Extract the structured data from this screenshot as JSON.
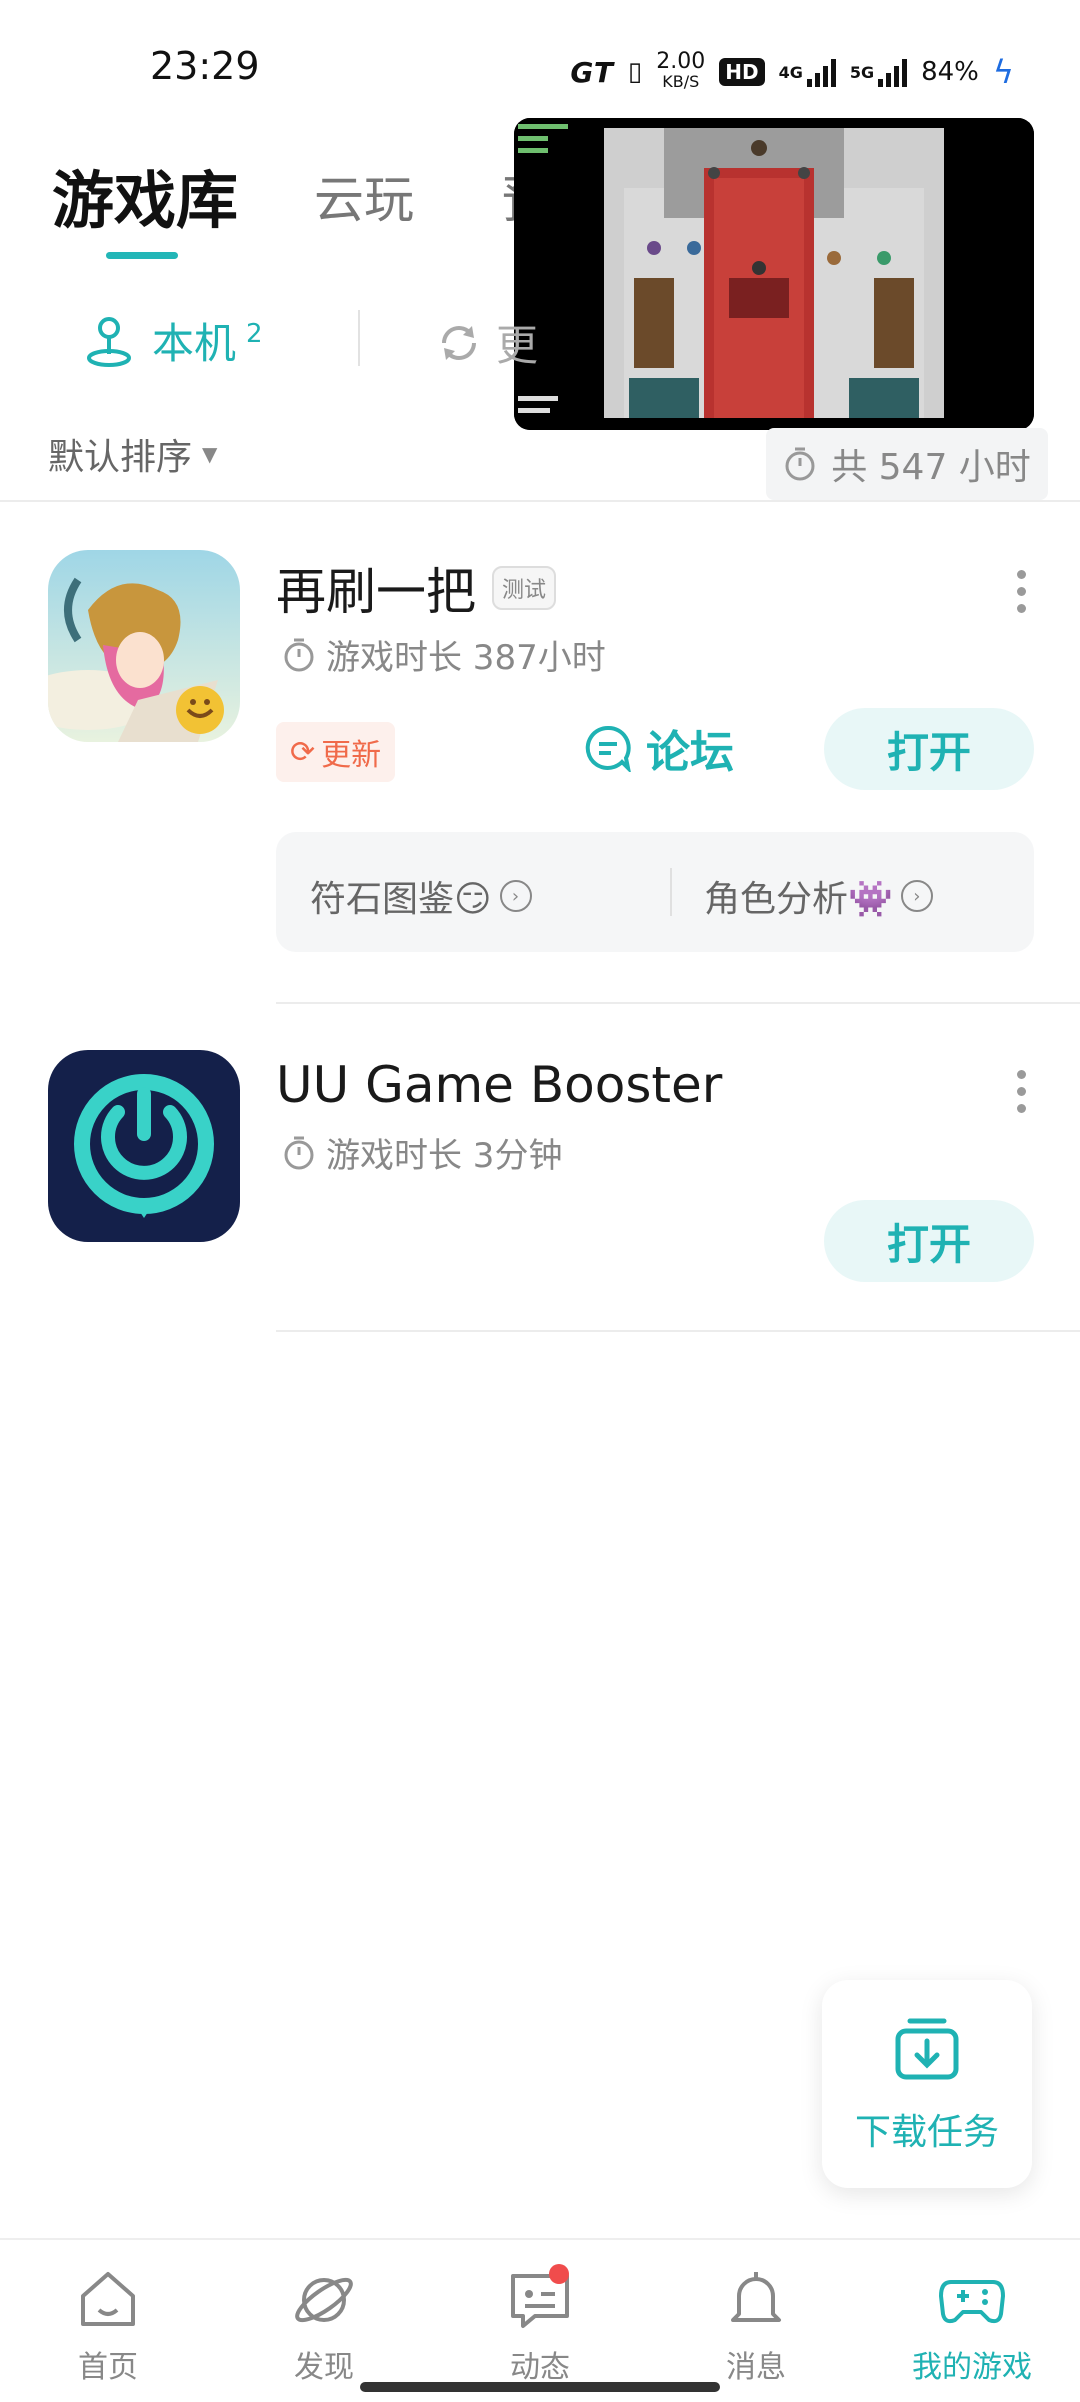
{
  "status_bar": {
    "time": "23:29",
    "brand": "GT",
    "speed_value": "2.00",
    "speed_unit": "KB/S",
    "hd": "HD",
    "network1": "4G",
    "network2": "5G",
    "battery": "84%"
  },
  "tabs": {
    "library": "游戏库",
    "cloud": "云玩",
    "third_partial": "预"
  },
  "sub_tabs": {
    "local_label": "本机",
    "local_count": "2",
    "update_partial": "更"
  },
  "sort_label": "默认排序",
  "total_time": "共 547 小时",
  "games": [
    {
      "name": "再刷一把",
      "badge": "测试",
      "play_time": "游戏时长 387小时",
      "update_label": "更新",
      "forum_label": "论坛",
      "open_label": "打开",
      "quick_links": [
        "符石图鉴😏",
        "角色分析👾"
      ]
    },
    {
      "name": "UU Game Booster",
      "play_time": "游戏时长 3分钟",
      "open_label": "打开"
    }
  ],
  "download_tasks": "下载任务",
  "bottom_nav": [
    {
      "label": "首页",
      "icon": "home-icon"
    },
    {
      "label": "发现",
      "icon": "planet-icon"
    },
    {
      "label": "动态",
      "icon": "chat-icon"
    },
    {
      "label": "消息",
      "icon": "bell-icon"
    },
    {
      "label": "我的游戏",
      "icon": "gamepad-icon"
    }
  ],
  "colors": {
    "accent": "#1fb2b3",
    "update": "#f06a4a",
    "notification_dot": "#f04c4c"
  }
}
